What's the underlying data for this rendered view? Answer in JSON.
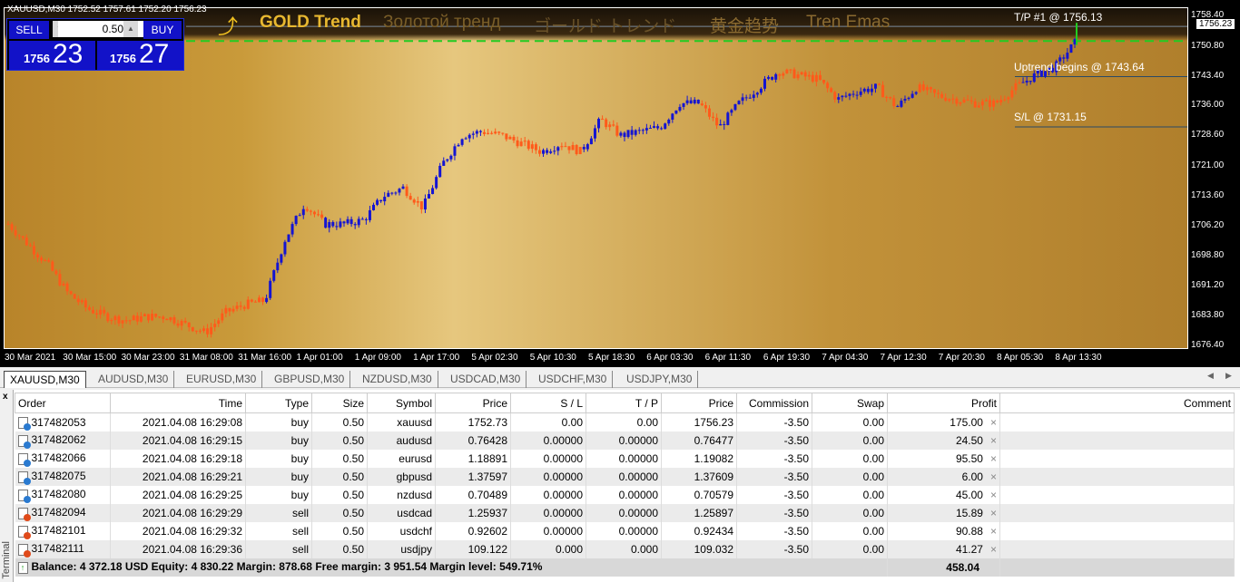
{
  "chart": {
    "symbol_line": "XAUUSD,M30  1752.52 1757.61 1752.20 1756.23",
    "trade_panel": {
      "sell_label": "SELL",
      "buy_label": "BUY",
      "lot": "0.50",
      "sell_small": "1756",
      "sell_large": "23",
      "buy_small": "1756",
      "buy_large": "27"
    },
    "banner": [
      "GOLD Trend",
      "Золотой тренд",
      "ゴールド トレンド",
      "黄金趋势",
      "Tren Emas"
    ],
    "labels": {
      "tp": "T/P #1 @ 1756.13",
      "uptrend": "Uptrend begins @ 1743.64",
      "sl": "S/L @ 1731.15"
    },
    "current_price": "1756.23",
    "y_ticks": [
      "1758.40",
      "1750.80",
      "1743.40",
      "1736.00",
      "1728.60",
      "1721.00",
      "1713.60",
      "1706.20",
      "1698.80",
      "1691.20",
      "1683.80",
      "1676.40"
    ],
    "x_ticks": [
      "30 Mar 2021",
      "30 Mar 15:00",
      "30 Mar 23:00",
      "31 Mar 08:00",
      "31 Mar 16:00",
      "1 Apr 01:00",
      "1 Apr 09:00",
      "1 Apr 17:00",
      "5 Apr 02:30",
      "5 Apr 10:30",
      "5 Apr 18:30",
      "6 Apr 03:30",
      "6 Apr 11:30",
      "6 Apr 19:30",
      "7 Apr 04:30",
      "7 Apr 12:30",
      "7 Apr 20:30",
      "8 Apr 05:30",
      "8 Apr 13:30"
    ],
    "price_path": [
      1707,
      1702,
      1697,
      1690,
      1686,
      1684,
      1683,
      1684,
      1684,
      1682,
      1680,
      1685,
      1687,
      1688,
      1703,
      1712,
      1707,
      1707,
      1708,
      1714,
      1716,
      1711,
      1722,
      1729,
      1730,
      1729,
      1727,
      1725,
      1727,
      1725,
      1733,
      1729,
      1730,
      1731,
      1737,
      1737,
      1731,
      1737,
      1741,
      1745,
      1744,
      1743,
      1738,
      1740,
      1741,
      1736,
      1741,
      1739,
      1738,
      1737,
      1737,
      1741,
      1744,
      1746,
      1752
    ],
    "colors": {
      "up": "#1414d2",
      "down": "#ff5a1a",
      "tp_line": "#22cc22",
      "level_line": "#2a4a66"
    }
  },
  "tabs": [
    "XAUUSD,M30",
    "AUDUSD,M30",
    "EURUSD,M30",
    "GBPUSD,M30",
    "NZDUSD,M30",
    "USDCAD,M30",
    "USDCHF,M30",
    "USDJPY,M30"
  ],
  "terminal": {
    "side_label": "Terminal",
    "columns": [
      "Order",
      "Time",
      "Type",
      "Size",
      "Symbol",
      "Price",
      "S / L",
      "T / P",
      "Price",
      "Commission",
      "Swap",
      "Profit",
      "Comment"
    ],
    "rows": [
      [
        "317482053",
        "2021.04.08 16:29:08",
        "buy",
        "0.50",
        "xauusd",
        "1752.73",
        "0.00",
        "0.00",
        "1756.23",
        "-3.50",
        "0.00",
        "175.00"
      ],
      [
        "317482062",
        "2021.04.08 16:29:15",
        "buy",
        "0.50",
        "audusd",
        "0.76428",
        "0.00000",
        "0.00000",
        "0.76477",
        "-3.50",
        "0.00",
        "24.50"
      ],
      [
        "317482066",
        "2021.04.08 16:29:18",
        "buy",
        "0.50",
        "eurusd",
        "1.18891",
        "0.00000",
        "0.00000",
        "1.19082",
        "-3.50",
        "0.00",
        "95.50"
      ],
      [
        "317482075",
        "2021.04.08 16:29:21",
        "buy",
        "0.50",
        "gbpusd",
        "1.37597",
        "0.00000",
        "0.00000",
        "1.37609",
        "-3.50",
        "0.00",
        "6.00"
      ],
      [
        "317482080",
        "2021.04.08 16:29:25",
        "buy",
        "0.50",
        "nzdusd",
        "0.70489",
        "0.00000",
        "0.00000",
        "0.70579",
        "-3.50",
        "0.00",
        "45.00"
      ],
      [
        "317482094",
        "2021.04.08 16:29:29",
        "sell",
        "0.50",
        "usdcad",
        "1.25937",
        "0.00000",
        "0.00000",
        "1.25897",
        "-3.50",
        "0.00",
        "15.89"
      ],
      [
        "317482101",
        "2021.04.08 16:29:32",
        "sell",
        "0.50",
        "usdchf",
        "0.92602",
        "0.00000",
        "0.00000",
        "0.92434",
        "-3.50",
        "0.00",
        "90.88"
      ],
      [
        "317482111",
        "2021.04.08 16:29:36",
        "sell",
        "0.50",
        "usdjpy",
        "109.122",
        "0.000",
        "0.000",
        "109.032",
        "-3.50",
        "0.00",
        "41.27"
      ]
    ],
    "balance_line": "Balance: 4 372.18 USD  Equity: 4 830.22  Margin: 878.68  Free margin: 3 951.54  Margin level: 549.71%",
    "total_profit": "458.04"
  }
}
